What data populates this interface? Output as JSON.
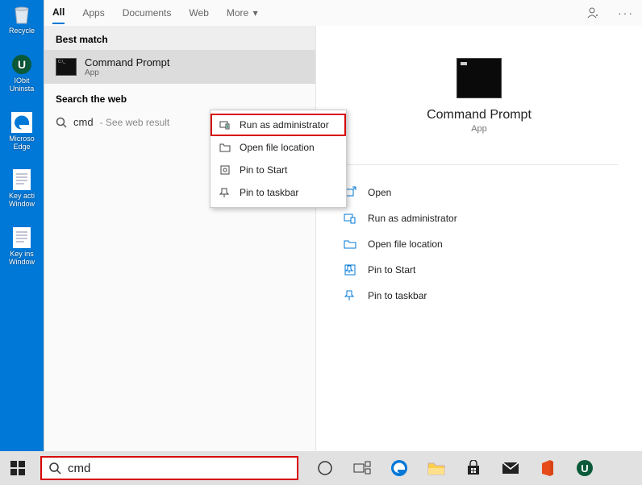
{
  "desktop": {
    "icons": [
      {
        "label": "Recycle"
      },
      {
        "label": "IObit Uninsta"
      },
      {
        "label": "Microso Edge"
      },
      {
        "label": "Key acti Window"
      },
      {
        "label": "Key ins Window"
      }
    ]
  },
  "search_panel": {
    "tabs": [
      "All",
      "Apps",
      "Documents",
      "Web",
      "More"
    ],
    "active_tab": "All",
    "best_match_heading": "Best match",
    "result": {
      "title": "Command Prompt",
      "subtitle": "App"
    },
    "search_web_heading": "Search the web",
    "web_query": "cmd",
    "web_hint": "- See web result"
  },
  "context_menu": {
    "items": [
      "Run as administrator",
      "Open file location",
      "Pin to Start",
      "Pin to taskbar"
    ]
  },
  "detail": {
    "title": "Command Prompt",
    "subtitle": "App",
    "actions": [
      "Open",
      "Run as administrator",
      "Open file location",
      "Pin to Start",
      "Pin to taskbar"
    ]
  },
  "taskbar": {
    "search_value": "cmd"
  }
}
